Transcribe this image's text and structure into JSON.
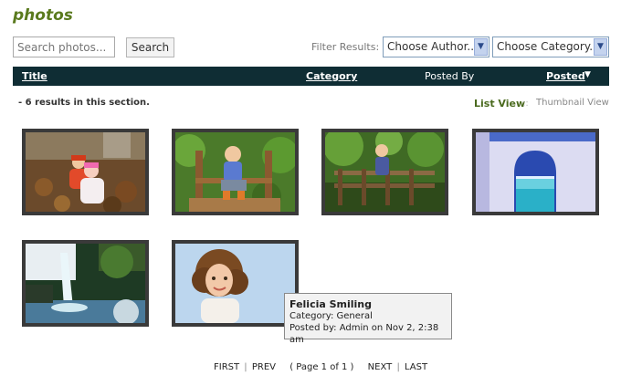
{
  "page": {
    "title": "photos"
  },
  "search": {
    "placeholder": "Search photos...",
    "button_label": "Search"
  },
  "filters": {
    "label": "Filter Results:",
    "author": {
      "selected": "Choose Author..."
    },
    "category": {
      "selected": "Choose Category..."
    }
  },
  "table_header": {
    "title": "Title",
    "category": "Category",
    "posted_by": "Posted By",
    "posted": "Posted",
    "sort_icon": "triangle-down-icon"
  },
  "results": {
    "summary": "- 6 results in this section."
  },
  "views": {
    "list": "List View",
    "separator": "::",
    "thumbnail": "Thumbnail View"
  },
  "photos": [
    {
      "subject": "child-on-leaves"
    },
    {
      "subject": "child-on-bench"
    },
    {
      "subject": "child-on-bridge"
    },
    {
      "subject": "arch-over-sea"
    },
    {
      "subject": "waterfall"
    },
    {
      "subject": "curly-haired-girl"
    }
  ],
  "tooltip": {
    "title": "Felicia Smiling",
    "category": "Category: General",
    "posted": "Posted by: Admin on Nov 2, 2:38 am"
  },
  "pagination": {
    "first": "FIRST",
    "prev": "PREV",
    "info": "( Page 1 of 1 )",
    "next": "NEXT",
    "last": "LAST",
    "separator": "|"
  },
  "colors": {
    "accent": "#5a7a1e",
    "header_bg": "#0f2d34"
  }
}
